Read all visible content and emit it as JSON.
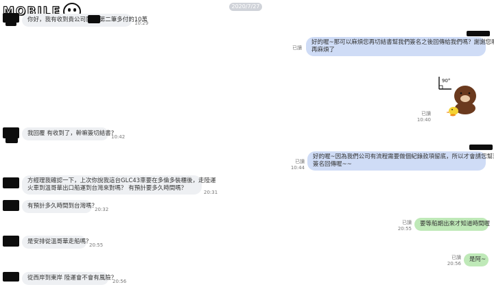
{
  "brand": {
    "logo_text": "MOBILE"
  },
  "date_separator": "2020/7/27",
  "messages": [
    {
      "side": "in",
      "text": "你好，我有收到貴公司匯款 第二筆多付的10萬",
      "time": "10:29"
    },
    {
      "side": "out",
      "lines": [
        "好的喔~那可以麻煩您再切結書幫我們簽名之後回傳給我們嗎？謝謝您喔，",
        "再麻煩了"
      ],
      "status": "已讀"
    },
    {
      "side": "out",
      "type": "sticker",
      "sticker_caption": "90°",
      "status": "已讀",
      "time": "10:40"
    },
    {
      "side": "in",
      "text": "我回覆 有收到了，幹嘛簽切結書?",
      "time": "10:42"
    },
    {
      "side": "out",
      "lines": [
        "好的喔~因為我們公司有流程需要做個紀錄款項留底，所以才會請您幫我們",
        "簽名回傳喔~~"
      ],
      "status": "已讀",
      "time": "10:44"
    },
    {
      "side": "in",
      "lines": [
        "方經理我確認一下，上次你說我這台GLC43車要在多倫多裝櫃後，走陸運",
        "火車到溫哥華出口船運到台灣來對嗎？ 有預計要多久時間嗎？"
      ],
      "time": "20:31"
    },
    {
      "side": "in",
      "text": "有預計多久時間到台灣嗎？",
      "time": "20:32"
    },
    {
      "side": "out",
      "text": "要等船期出來才知道時間喔",
      "status": "已讀",
      "time": "20:55"
    },
    {
      "side": "in",
      "text": "是安排從溫哥華走船嗎？",
      "time": "20:55"
    },
    {
      "side": "out",
      "text": "是阿~",
      "status": "已讀",
      "time": "20:56"
    },
    {
      "side": "in",
      "text": "從西岸到東岸 陸運會不會有風險？",
      "time": "20:56"
    }
  ],
  "colors": {
    "incoming_bubble": "#eef0f3",
    "outgoing_bubble": "#cfdcf6",
    "green_bubble": "#bfe9b8",
    "date_pill": "#d0d3d9",
    "redaction": "#0d0d0d"
  }
}
